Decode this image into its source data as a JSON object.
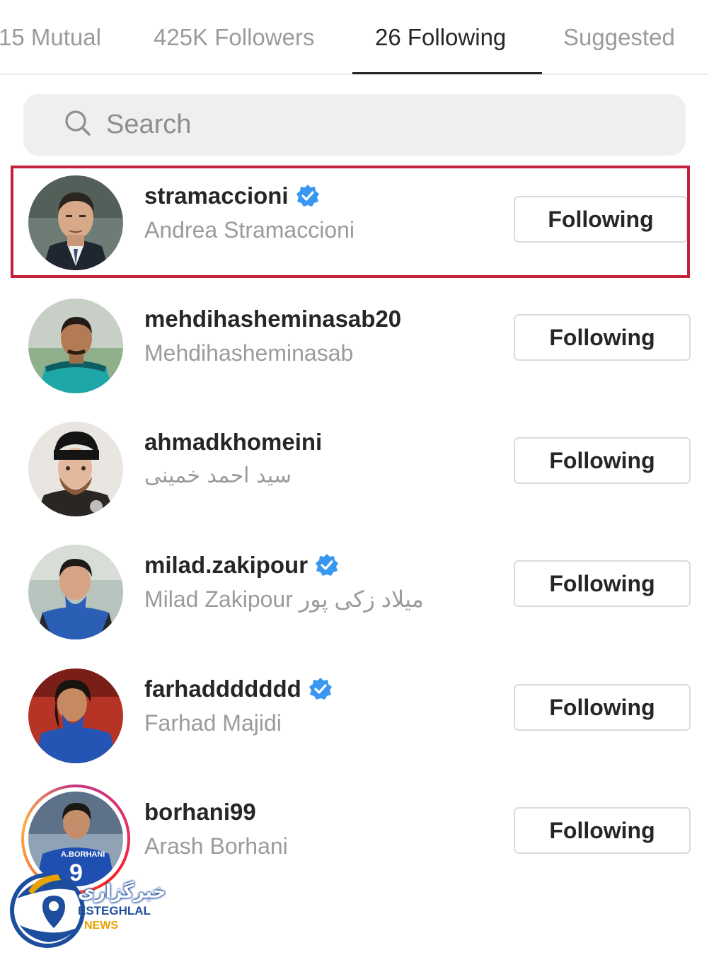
{
  "tabs": [
    {
      "label": "15 Mutual",
      "active": false
    },
    {
      "label": "425K Followers",
      "active": false
    },
    {
      "label": "26 Following",
      "active": true
    },
    {
      "label": "Suggested",
      "active": false
    }
  ],
  "search": {
    "placeholder": "Search",
    "icon": "search-icon"
  },
  "accounts": [
    {
      "username": "stramaccioni",
      "full_name": "Andrea Stramaccioni",
      "verified": true,
      "button": "Following",
      "highlighted": true
    },
    {
      "username": "mehdihasheminasab20",
      "full_name": "Mehdihasheminasab",
      "verified": false,
      "button": "Following"
    },
    {
      "username": "ahmadkhomeini",
      "full_name": "سید احمد خمینی",
      "verified": false,
      "button": "Following"
    },
    {
      "username": "milad.zakipour",
      "full_name": "Milad Zakipour میلاد زکی پور",
      "verified": true,
      "button": "Following"
    },
    {
      "username": "farhaddddddd",
      "full_name": "Farhad Majidi",
      "verified": true,
      "button": "Following"
    },
    {
      "username": "borhani99",
      "full_name": "Arash Borhani",
      "verified": false,
      "button": "Following",
      "story_ring": true
    }
  ],
  "watermark": {
    "title_fa": "خبرگزاری",
    "title_en": "ESTEGHLAL",
    "subtitle": "NEWS"
  },
  "colors": {
    "text_primary": "#262626",
    "text_secondary": "#9b9b9b",
    "verified_blue": "#3897f0",
    "highlight_red": "#c4213a",
    "search_bg": "#efefef",
    "button_border": "#dbdbdb"
  }
}
